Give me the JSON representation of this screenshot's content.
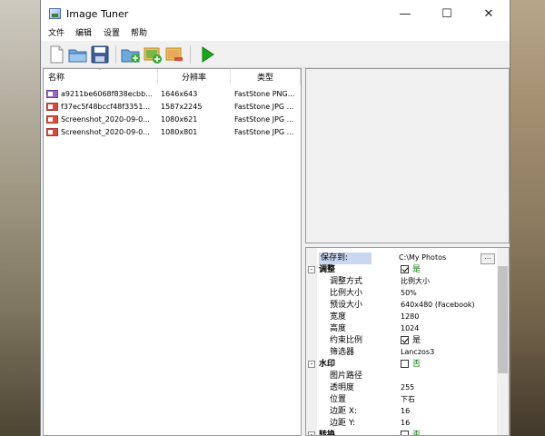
{
  "window": {
    "title": "Image Tuner"
  },
  "menu": [
    "文件",
    "编辑",
    "设置",
    "帮助"
  ],
  "toolbar": {
    "buttons": [
      "new-icon",
      "open-folder-icon",
      "save-icon",
      "add-folder-icon",
      "add-images-icon",
      "remove-image-icon",
      "run-icon"
    ]
  },
  "file_list": {
    "columns": [
      "名称",
      "分辨率",
      "类型"
    ],
    "rows": [
      {
        "name": "a9211be6068f838ecbb...",
        "resolution": "1646x643",
        "type": "FastStone PNG...",
        "icon": "png-file-icon"
      },
      {
        "name": "f37ec5f48bccf48f3351...",
        "resolution": "1587x2245",
        "type": "FastStone JPG ...",
        "icon": "jpg-file-icon"
      },
      {
        "name": "Screenshot_2020-09-0...",
        "resolution": "1080x621",
        "type": "FastStone JPG ...",
        "icon": "jpg-file-icon"
      },
      {
        "name": "Screenshot_2020-09-0...",
        "resolution": "1080x801",
        "type": "FastStone JPG ...",
        "icon": "jpg-file-icon"
      }
    ]
  },
  "properties": {
    "save_to_label": "保存到:",
    "save_to_value": "C:\\My Photos",
    "browse_label": "...",
    "resize": {
      "label": "调整",
      "enabled_label": "是",
      "items": [
        {
          "label": "调整方式",
          "value": "比例大小"
        },
        {
          "label": "比例大小",
          "value": "50%"
        },
        {
          "label": "预设大小",
          "value": "640x480 (Facebook)"
        },
        {
          "label": "宽度",
          "value": "1280"
        },
        {
          "label": "高度",
          "value": "1024"
        }
      ],
      "keep_ratio_label": "约束比例",
      "keep_ratio_value": "是",
      "filter_label": "筛选器",
      "filter_value": "Lanczos3"
    },
    "watermark": {
      "label": "水印",
      "enabled_label": "否",
      "items": [
        {
          "label": "图片路径",
          "value": ""
        },
        {
          "label": "透明度",
          "value": "255"
        },
        {
          "label": "位置",
          "value": "下右"
        },
        {
          "label": "边距 X:",
          "value": "16"
        },
        {
          "label": "边距 Y:",
          "value": "16"
        }
      ]
    },
    "next_category": {
      "label": "转换",
      "enabled_label": "否"
    }
  },
  "colors": {
    "run_green": "#1aa81a",
    "selected_label_bg": "#c9d7f0"
  }
}
